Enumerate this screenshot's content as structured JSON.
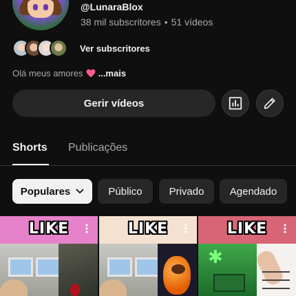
{
  "channel": {
    "handle": "@LunaraBlox",
    "subscribers": "38 mil subscritores",
    "separator": "•",
    "videos": "51 vídeos",
    "see_subscribers": "Ver subscritores",
    "description": "Olá meus amores",
    "more_label": "...mais"
  },
  "actions": {
    "manage_videos": "Gerir vídeos",
    "stats_icon": "analytics-icon",
    "edit_icon": "pencil-icon"
  },
  "tabs": [
    {
      "label": "Shorts",
      "selected": true
    },
    {
      "label": "Publicações",
      "selected": false
    }
  ],
  "filters": [
    {
      "label": "Populares",
      "selected": true
    },
    {
      "label": "Público",
      "selected": false
    },
    {
      "label": "Privado",
      "selected": false
    },
    {
      "label": "Agendado",
      "selected": false
    }
  ],
  "shorts": [
    {
      "overlay": "LIKE",
      "color": "#e682c9"
    },
    {
      "overlay": "LIKE",
      "color": "#f4e1cf"
    },
    {
      "overlay": "LIKE",
      "color": "#d86576"
    }
  ],
  "colors": {
    "background": "#0f0f0f",
    "surface": "#272727",
    "text": "#f1f1f1",
    "muted": "#aaaaaa",
    "heart": "#ff5c8a"
  }
}
